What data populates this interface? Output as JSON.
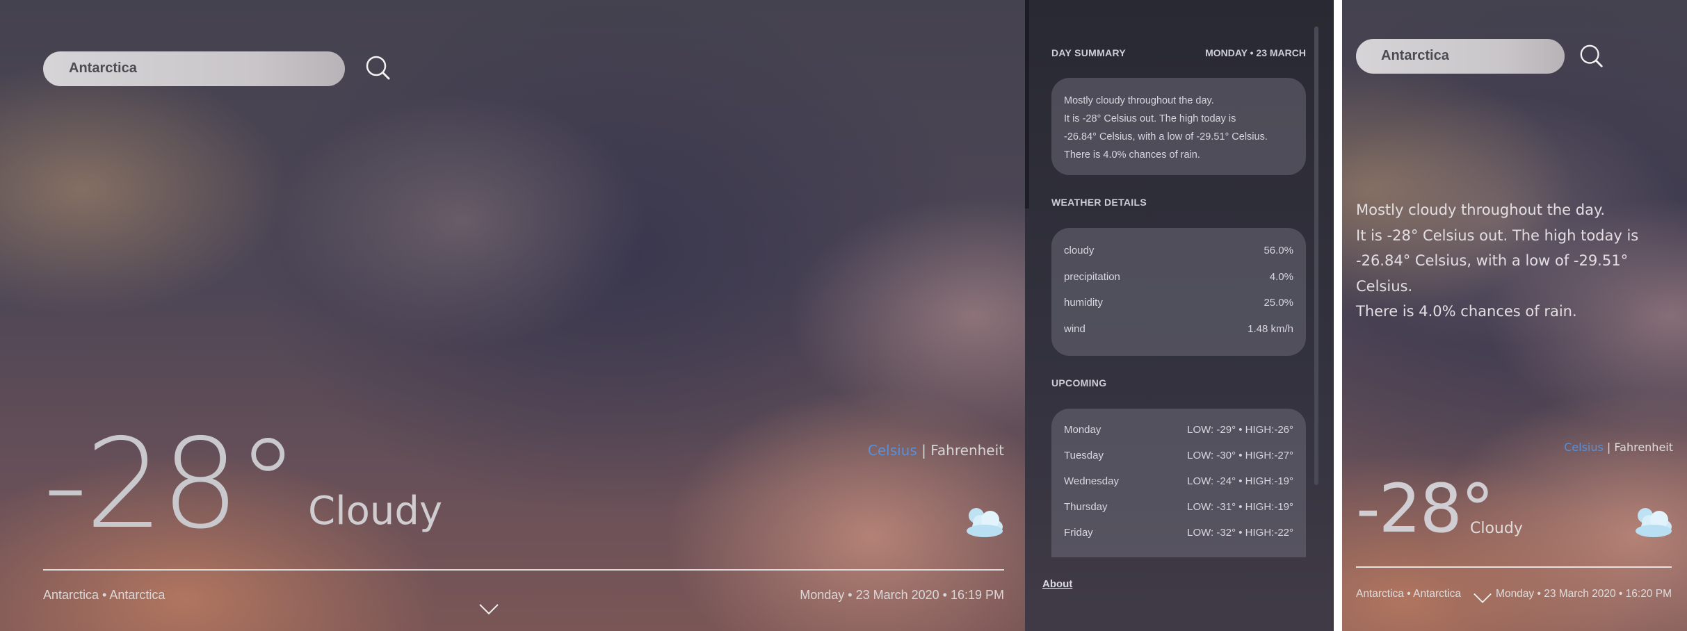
{
  "main": {
    "search_value": "Antarctica",
    "temperature": "-28°",
    "condition": "Cloudy",
    "units": {
      "celsius": "Celsius",
      "separator": "|",
      "fahrenheit": "Fahrenheit",
      "active": "Celsius"
    },
    "location": "Antarctica • Antarctica",
    "datetime": "Monday • 23 March 2020 • 16:19 PM",
    "weather_icon": "partly-cloudy-icon"
  },
  "panel": {
    "summary_heading": "DAY SUMMARY",
    "summary_date": "MONDAY • 23 MARCH",
    "summary_lines": [
      "Mostly cloudy throughout the day.",
      "It is -28° Celsius out. The high today is",
      "-26.84° Celsius, with a low of -29.51° Celsius.",
      "There is 4.0% chances of rain."
    ],
    "details_heading": "WEATHER DETAILS",
    "details": [
      {
        "label": "cloudy",
        "value": "56.0%"
      },
      {
        "label": "precipitation",
        "value": "4.0%"
      },
      {
        "label": "humidity",
        "value": "25.0%"
      },
      {
        "label": "wind",
        "value": "1.48 km/h"
      }
    ],
    "upcoming_heading": "UPCOMING",
    "upcoming": [
      {
        "day": "Monday",
        "range": "LOW: -29° • HIGH:-26°"
      },
      {
        "day": "Tuesday",
        "range": "LOW: -30° • HIGH:-27°"
      },
      {
        "day": "Wednesday",
        "range": "LOW: -24° • HIGH:-19°"
      },
      {
        "day": "Thursday",
        "range": "LOW: -31° • HIGH:-19°"
      },
      {
        "day": "Friday",
        "range": "LOW: -32° • HIGH:-22°"
      }
    ],
    "about_link": "About"
  },
  "mobile": {
    "search_value": "Antarctica",
    "summary_lines": [
      "Mostly cloudy throughout the day.",
      "It is -28° Celsius out. The high today is",
      "-26.84° Celsius, with a low of -29.51° Celsius.",
      "There is 4.0% chances of rain."
    ],
    "units": {
      "celsius": "Celsius",
      "separator": "|",
      "fahrenheit": "Fahrenheit",
      "active": "Celsius"
    },
    "temperature": "-28°",
    "condition": "Cloudy",
    "location": "Antarctica • Antarctica",
    "datetime": "Monday • 23 March 2020 • 16:20 PM",
    "weather_icon": "partly-cloudy-icon"
  },
  "colors": {
    "accent": "#5b8fd6",
    "panel_bg": "#23232d",
    "card_bg": "#5f5d69",
    "text": "#d8d6de"
  }
}
